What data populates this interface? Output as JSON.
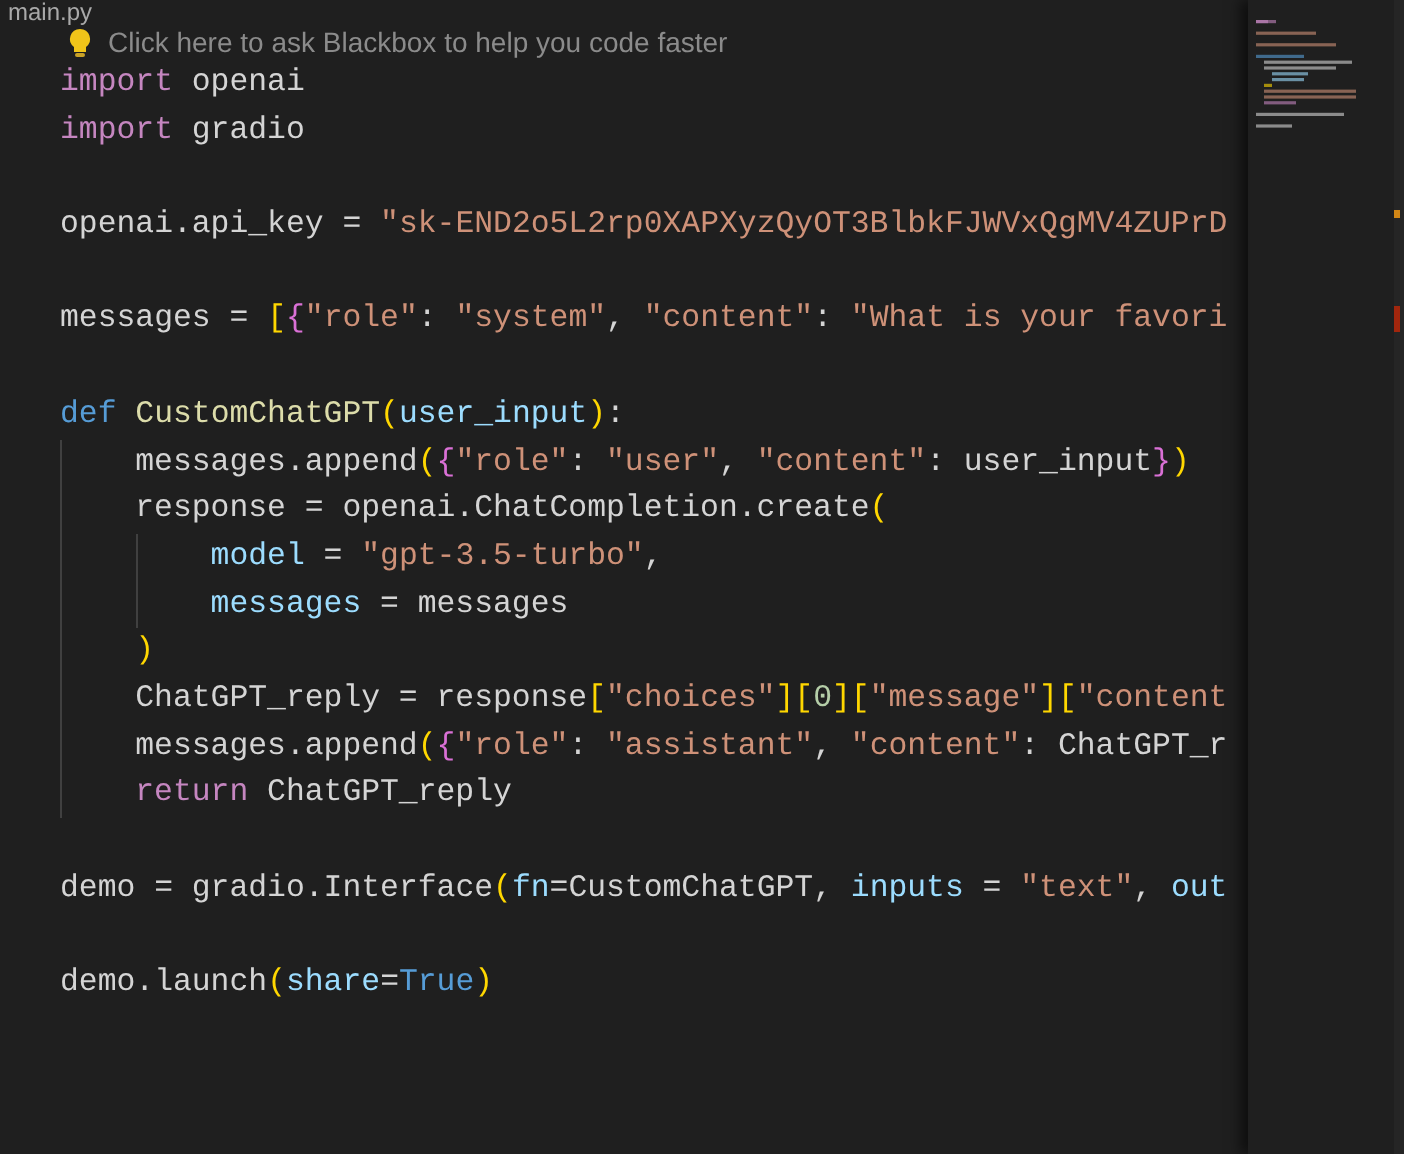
{
  "file_name": "main.py",
  "hint": "Click here to ask Blackbox to help you code faster",
  "lines": [
    {
      "tokens": [
        {
          "kind": "control",
          "text": "import"
        },
        {
          "kind": "plain",
          "text": " openai"
        }
      ]
    },
    {
      "tokens": [
        {
          "kind": "control",
          "text": "import"
        },
        {
          "kind": "plain",
          "text": " gradio"
        }
      ]
    },
    {
      "kind": "blank"
    },
    {
      "tokens": [
        {
          "kind": "plain",
          "text": "openai.api_key = "
        },
        {
          "kind": "string",
          "text": "\"sk-END2o5L2rp0XAPXyzQyOT3BlbkFJWVxQgMV4ZUPrD"
        }
      ]
    },
    {
      "kind": "blank"
    },
    {
      "tokens": [
        {
          "kind": "plain",
          "text": "messages = "
        },
        {
          "kind": "bracket1",
          "text": "["
        },
        {
          "kind": "bracket2",
          "text": "{"
        },
        {
          "kind": "string",
          "text": "\"role\""
        },
        {
          "kind": "plain",
          "text": ": "
        },
        {
          "kind": "string",
          "text": "\"system\""
        },
        {
          "kind": "plain",
          "text": ", "
        },
        {
          "kind": "string",
          "text": "\"content\""
        },
        {
          "kind": "plain",
          "text": ": "
        },
        {
          "kind": "string",
          "text": "\"What is your favori"
        }
      ]
    },
    {
      "kind": "blank"
    },
    {
      "tokens": [
        {
          "kind": "storage",
          "text": "def"
        },
        {
          "kind": "func",
          "text": " CustomChatGPT"
        },
        {
          "kind": "bracket1",
          "text": "("
        },
        {
          "kind": "var",
          "text": "user_input"
        },
        {
          "kind": "bracket1",
          "text": ")"
        },
        {
          "kind": "plain",
          "text": ":"
        }
      ],
      "children": [
        {
          "tokens": [
            {
              "kind": "plain",
              "text": "messages.append"
            },
            {
              "kind": "bracket1",
              "text": "("
            },
            {
              "kind": "bracket2",
              "text": "{"
            },
            {
              "kind": "string",
              "text": "\"role\""
            },
            {
              "kind": "plain",
              "text": ": "
            },
            {
              "kind": "string",
              "text": "\"user\""
            },
            {
              "kind": "plain",
              "text": ", "
            },
            {
              "kind": "string",
              "text": "\"content\""
            },
            {
              "kind": "plain",
              "text": ": user_input"
            },
            {
              "kind": "bracket2",
              "text": "}"
            },
            {
              "kind": "bracket1",
              "text": ")"
            }
          ]
        },
        {
          "tokens": [
            {
              "kind": "plain",
              "text": "response = openai.ChatCompletion.create"
            },
            {
              "kind": "bracket1",
              "text": "("
            }
          ],
          "children": [
            {
              "tokens": [
                {
                  "kind": "var",
                  "text": "model"
                },
                {
                  "kind": "plain",
                  "text": " = "
                },
                {
                  "kind": "string",
                  "text": "\"gpt-3.5-turbo\""
                },
                {
                  "kind": "plain",
                  "text": ","
                }
              ]
            },
            {
              "tokens": [
                {
                  "kind": "var",
                  "text": "messages"
                },
                {
                  "kind": "plain",
                  "text": " = messages"
                }
              ]
            }
          ]
        },
        {
          "tokens": [
            {
              "kind": "bracket1",
              "text": ")"
            }
          ]
        },
        {
          "tokens": [
            {
              "kind": "plain",
              "text": "ChatGPT_reply = response"
            },
            {
              "kind": "bracket1",
              "text": "["
            },
            {
              "kind": "string",
              "text": "\"choices\""
            },
            {
              "kind": "bracket1",
              "text": "]["
            },
            {
              "kind": "number",
              "text": "0"
            },
            {
              "kind": "bracket1",
              "text": "]["
            },
            {
              "kind": "string",
              "text": "\"message\""
            },
            {
              "kind": "bracket1",
              "text": "]["
            },
            {
              "kind": "string",
              "text": "\"content"
            }
          ]
        },
        {
          "tokens": [
            {
              "kind": "plain",
              "text": "messages.append"
            },
            {
              "kind": "bracket1",
              "text": "("
            },
            {
              "kind": "bracket2",
              "text": "{"
            },
            {
              "kind": "string",
              "text": "\"role\""
            },
            {
              "kind": "plain",
              "text": ": "
            },
            {
              "kind": "string",
              "text": "\"assistant\""
            },
            {
              "kind": "plain",
              "text": ", "
            },
            {
              "kind": "string",
              "text": "\"content\""
            },
            {
              "kind": "plain",
              "text": ": ChatGPT_r"
            }
          ]
        },
        {
          "tokens": [
            {
              "kind": "control",
              "text": "return"
            },
            {
              "kind": "plain",
              "text": " ChatGPT_reply"
            }
          ]
        }
      ]
    },
    {
      "kind": "blank"
    },
    {
      "tokens": [
        {
          "kind": "plain",
          "text": "demo = gradio.Interface"
        },
        {
          "kind": "bracket1",
          "text": "("
        },
        {
          "kind": "var",
          "text": "fn"
        },
        {
          "kind": "plain",
          "text": "=CustomChatGPT, "
        },
        {
          "kind": "var",
          "text": "inputs"
        },
        {
          "kind": "plain",
          "text": " = "
        },
        {
          "kind": "string",
          "text": "\"text\""
        },
        {
          "kind": "plain",
          "text": ", "
        },
        {
          "kind": "var",
          "text": "out"
        }
      ]
    },
    {
      "kind": "blank"
    },
    {
      "tokens": [
        {
          "kind": "plain",
          "text": "demo.launch"
        },
        {
          "kind": "bracket1",
          "text": "("
        },
        {
          "kind": "var",
          "text": "share"
        },
        {
          "kind": "plain",
          "text": "="
        },
        {
          "kind": "storage",
          "text": "True"
        },
        {
          "kind": "bracket1",
          "text": ")"
        }
      ]
    }
  ]
}
